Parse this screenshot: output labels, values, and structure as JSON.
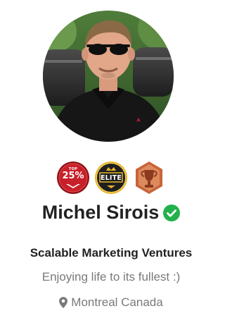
{
  "profile": {
    "name": "Michel Sirois",
    "verified_icon": "verified-check-icon",
    "company": "Scalable Marketing Ventures",
    "tagline": "Enjoying life to its fullest :)",
    "location": "Montreal Canada",
    "location_icon": "map-pin-icon"
  },
  "badges": {
    "top": {
      "small_label": "TOP",
      "big_label": "25%",
      "icon": "top-25-percent-badge-icon"
    },
    "elite": {
      "label": "ELITE",
      "icon": "elite-badge-icon"
    },
    "trophy": {
      "icon": "trophy-badge-icon"
    }
  },
  "colors": {
    "verified": "#22b14c",
    "top_badge": "#c8202a",
    "elite_badge": "#1f1f1f",
    "elite_gold": "#e7b528",
    "trophy_badge": "#c8643a",
    "name_text": "#222222",
    "secondary_text": "#7a7a7a"
  }
}
